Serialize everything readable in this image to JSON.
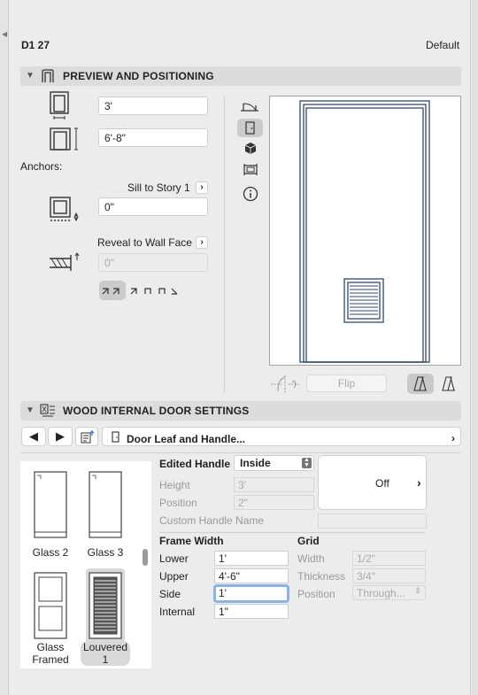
{
  "header": {
    "id_label": "D1 27",
    "style_label": "Default"
  },
  "preview_section": {
    "title": "PREVIEW AND POSITIONING",
    "width_value": "3'",
    "height_value": "6'-8\"",
    "anchors_label": "Anchors:",
    "sill_label": "Sill to Story 1",
    "sill_value": "0\"",
    "reveal_label": "Reveal to Wall Face",
    "reveal_value": "0\"",
    "flip_label": "Flip",
    "view_icons": [
      "plan-view-icon",
      "elevation-view-icon",
      "3d-view-icon",
      "section-view-icon",
      "info-icon"
    ]
  },
  "door_section": {
    "title": "WOOD INTERNAL DOOR SETTINGS",
    "page_label": "Door Leaf and Handle...",
    "list_items": [
      {
        "label": "Glass 2"
      },
      {
        "label": "Glass 3"
      },
      {
        "label": "Glass\nFramed"
      },
      {
        "label": "Louvered\n1",
        "selected": true
      }
    ],
    "edited_handle_label": "Edited Handle",
    "edited_handle_value": "Inside",
    "handle_height_label": "Height",
    "handle_height_value": "3'",
    "handle_position_label": "Position",
    "handle_position_value": "2\"",
    "custom_name_label": "Custom Handle Name",
    "handle_state": "Off",
    "frame_width_label": "Frame Width",
    "lower_label": "Lower",
    "lower_value": "1'",
    "upper_label": "Upper",
    "upper_value": "4'-6\"",
    "side_label": "Side",
    "side_value": "1'",
    "internal_label": "Internal",
    "internal_value": "1\"",
    "grid_label": "Grid",
    "grid_width_label": "Width",
    "grid_width_value": "1/2\"",
    "grid_thickness_label": "Thickness",
    "grid_thickness_value": "3/4\"",
    "grid_position_label": "Position",
    "grid_position_value": "Through..."
  },
  "colors": {
    "accent": "#3a5f8a",
    "selection": "#d9d9d9",
    "focus": "#8ab4e8"
  }
}
